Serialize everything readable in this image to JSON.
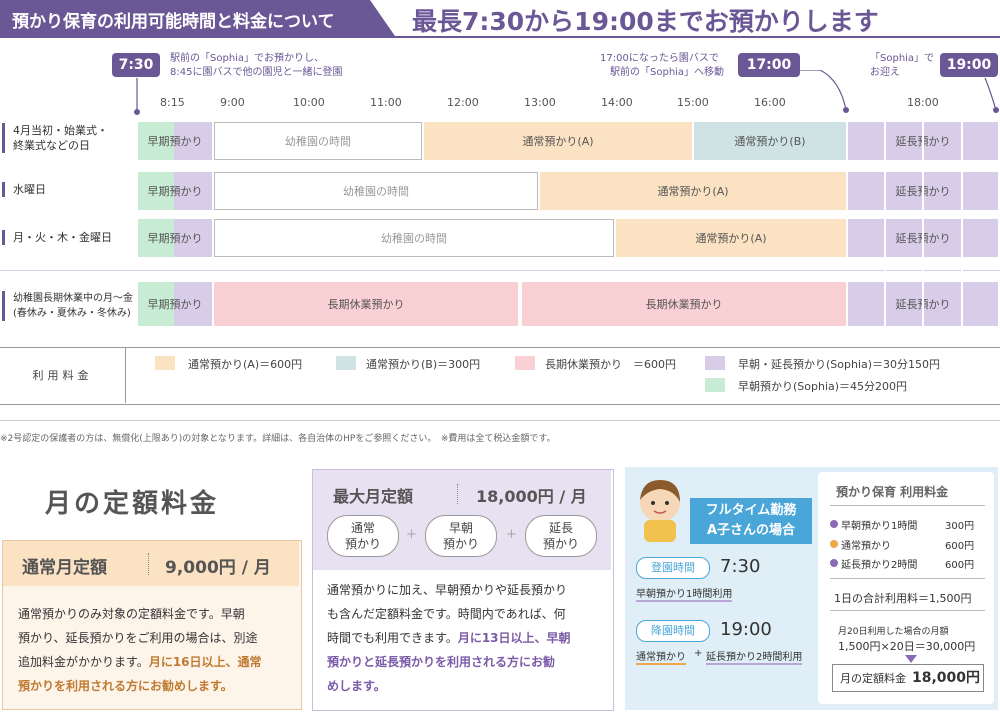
{
  "header": {
    "title": "預かり保育の利用可能時間と料金について",
    "subtitle": "最長7:30から19:00までお預かりします"
  },
  "timeline": {
    "badges": [
      "7:30",
      "17:00",
      "19:00"
    ],
    "notes": {
      "start": [
        "駅前の「Sophia」でお預かりし、",
        "8:45に園バスで他の園児と一緒に登園"
      ],
      "bus": [
        "17:00になったら園バスで",
        "駅前の「Sophia」へ移動"
      ],
      "end": [
        "「Sophia」で",
        "お迎え"
      ]
    },
    "ticks": [
      "8:15",
      "9:00",
      "10:00",
      "11:00",
      "12:00",
      "13:00",
      "14:00",
      "15:00",
      "16:00",
      "18:00"
    ]
  },
  "rows": [
    {
      "label": [
        "4月当初・始業式・",
        "終業式などの日"
      ],
      "segments": [
        "早期預かり",
        "幼稚園の時間",
        "通常預かり(A)",
        "通常預かり(B)",
        "延長預かり"
      ]
    },
    {
      "label": [
        "水曜日"
      ],
      "segments": [
        "早期預かり",
        "幼稚園の時間",
        "通常預かり(A)",
        "延長預かり"
      ]
    },
    {
      "label": [
        "月・火・木・金曜日"
      ],
      "segments": [
        "早期預かり",
        "幼稚園の時間",
        "通常預かり(A)",
        "延長預かり"
      ]
    },
    {
      "label": [
        "幼稚園長期休業中の月〜金",
        "(春休み・夏休み・冬休み)"
      ],
      "segments": [
        "早期預かり",
        "長期休業預かり",
        "長期休業預かり",
        "延長預かり"
      ]
    }
  ],
  "legend": {
    "title": "利用料金",
    "items": [
      {
        "text": "通常預かり(A)＝600円",
        "color": "#fbe2c3"
      },
      {
        "text": "通常預かり(B)＝300円",
        "color": "#cfe3e4"
      },
      {
        "text": "長期休業預かり　＝600円",
        "color": "#f9d0d4"
      },
      {
        "text": "早朝・延長預かり(Sophia)＝30分150円",
        "color": "#d8cde8"
      },
      {
        "text": "早朝預かり(Sophia)＝45分200円",
        "color": "#c8ecd3"
      }
    ]
  },
  "footnote": "※2号認定の保護者の方は、無償化(上限あり)の対象となります。詳細は、各自治体のHPをご参照ください。　※費用は全て税込金額です。",
  "monthly": {
    "title": "月の定額料金",
    "plan1": {
      "name": "通常月定額",
      "price": "9,000円 / 月",
      "desc1": "通常預かりのみ対象の定額料金です。早朝",
      "desc2": "預かり、延長預かりをご利用の場合は、別途",
      "desc3": "追加料金がかかります。",
      "hl1": "月に16日以上、通常",
      "hl2": "預かりを利用される方にお勧めします。"
    },
    "plan2": {
      "name": "最大月定額",
      "price": "18,000円 / 月",
      "pills": [
        [
          "通常",
          "預かり"
        ],
        [
          "早朝",
          "預かり"
        ],
        [
          "延長",
          "預かり"
        ]
      ],
      "plus": "+",
      "desc1": "通常預かりに加え、早朝預かりや延長預かり",
      "desc2": "も含んだ定額料金です。時間内であれば、何",
      "desc3": "時間でも利用できます。",
      "hl1": "月に13日以上、早朝",
      "hl2": "預かりと延長預かりを利用される方にお勧",
      "hl3": "めします。"
    }
  },
  "example": {
    "title": "フルタイム勤務",
    "title2": "A子さんの場合",
    "arrive_label": "登園時間",
    "arrive_time": "7:30",
    "arrive_note": "早朝預かり1時間利用",
    "leave_label": "降園時間",
    "leave_time": "19:00",
    "leave_note_a": "通常預かり",
    "leave_plus": "+",
    "leave_note_b": "延長預かり2時間利用",
    "card_title": "預かり保育 利用料金",
    "lines": [
      {
        "label": "早朝預かり1時間",
        "value": "300円",
        "color": "#8a6bb8"
      },
      {
        "label": "通常預かり",
        "value": "600円",
        "color": "#f0a64a"
      },
      {
        "label": "延長預かり2時間",
        "value": "600円",
        "color": "#8a6bb8"
      }
    ],
    "daily": "1日の合計利用料＝1,500円",
    "month_note": "月20日利用した場合の月額",
    "month_calc": "1,500円×20日＝30,000円",
    "final_label": "月の定額料金",
    "final_value": "18,000円"
  }
}
